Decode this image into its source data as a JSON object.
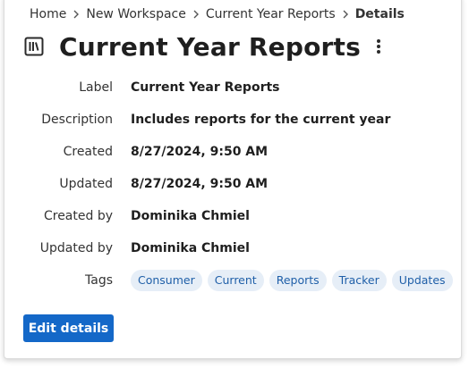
{
  "breadcrumb": {
    "items": [
      "Home",
      "New Workspace",
      "Current Year Reports"
    ],
    "current": "Details"
  },
  "header": {
    "title": "Current Year Reports",
    "icon": "library-icon",
    "menu_icon": "more-vertical-icon"
  },
  "details": {
    "label": {
      "name": "Label",
      "value": "Current Year Reports"
    },
    "description": {
      "name": "Description",
      "value": "Includes reports for the current year"
    },
    "created": {
      "name": "Created",
      "value": "8/27/2024, 9:50 AM"
    },
    "updated": {
      "name": "Updated",
      "value": "8/27/2024, 9:50 AM"
    },
    "created_by": {
      "name": "Created by",
      "value": "Dominika Chmiel"
    },
    "updated_by": {
      "name": "Updated by",
      "value": "Dominika Chmiel"
    },
    "tags": {
      "name": "Tags",
      "values": [
        "Consumer",
        "Current",
        "Reports",
        "Tracker",
        "Updates"
      ]
    }
  },
  "actions": {
    "edit_label": "Edit details"
  },
  "colors": {
    "accent": "#1468c8",
    "tag_bg": "#e6eef7",
    "tag_text": "#1f5fa8"
  }
}
